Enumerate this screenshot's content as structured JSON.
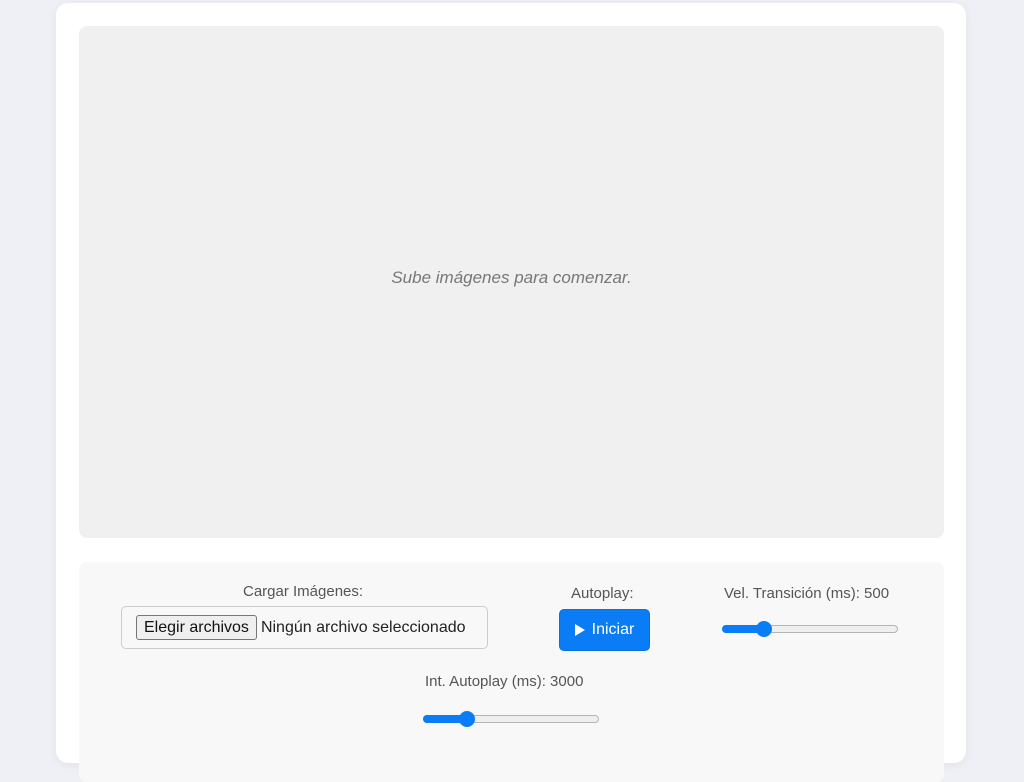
{
  "viewer": {
    "placeholder": "Sube imágenes para comenzar."
  },
  "controls": {
    "upload": {
      "label": "Cargar Imágenes:",
      "button_label": "Elegir archivos",
      "status": "Ningún archivo seleccionado"
    },
    "autoplay": {
      "label": "Autoplay:",
      "button_label": "Iniciar",
      "icon": "play-icon"
    },
    "transition_speed": {
      "label": "Vel. Transición (ms): 500",
      "value": 500,
      "min": 100,
      "max": 2000
    },
    "autoplay_interval": {
      "label": "Int. Autoplay (ms): 3000",
      "value": 3000,
      "min": 1000,
      "max": 10000
    }
  },
  "colors": {
    "accent": "#0a7cf6",
    "page_background": "#eef0f5",
    "viewer_background": "#f0f0f0"
  }
}
